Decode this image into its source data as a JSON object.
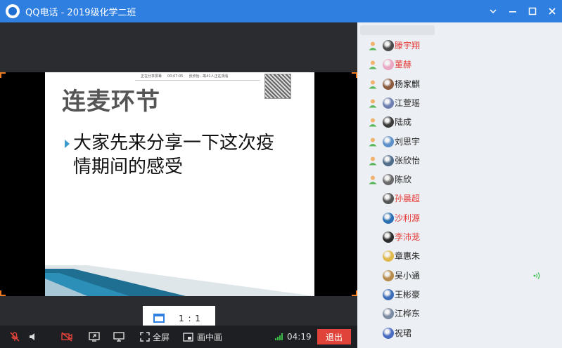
{
  "window": {
    "title": "QQ电话 - 2019级化学二班"
  },
  "slide": {
    "heading": "连麦环节",
    "bullet_line1": "大家先来分享一下这次疫",
    "bullet_line2": "情期间的感受",
    "bar_text_1": "正在分享屏幕",
    "bar_text_2": "00:07:05",
    "bar_text_3": "张欣怡...等41人正在观看"
  },
  "ratio_button": {
    "label": "1 : 1"
  },
  "toolbar": {
    "fullscreen_label": "全屏",
    "pip_label": "画中画",
    "duration": "04:19",
    "exit_label": "退出"
  },
  "members": [
    {
      "name": "滕宇翔",
      "color": "#e53935",
      "speaking": false,
      "avatar_color": "#4a4a4a",
      "indent": false
    },
    {
      "name": "董赫",
      "color": "#e53935",
      "speaking": false,
      "avatar_color": "#e9a7c4",
      "indent": false
    },
    {
      "name": "杨家麒",
      "color": "#222222",
      "speaking": false,
      "avatar_color": "#8a5a3c",
      "indent": false
    },
    {
      "name": "江萱瑶",
      "color": "#222222",
      "speaking": false,
      "avatar_color": "#6d7fb0",
      "indent": false
    },
    {
      "name": "陆成",
      "color": "#222222",
      "speaking": false,
      "avatar_color": "#3b3b3b",
      "indent": false
    },
    {
      "name": "刘思宇",
      "color": "#222222",
      "speaking": false,
      "avatar_color": "#5d8fc9",
      "indent": false
    },
    {
      "name": "张欣怡",
      "color": "#222222",
      "speaking": false,
      "avatar_color": "#4f6b8a",
      "indent": false
    },
    {
      "name": "陈欣",
      "color": "#222222",
      "speaking": false,
      "avatar_color": "#6a6a6a",
      "indent": false
    },
    {
      "name": "孙晨超",
      "color": "#e53935",
      "speaking": false,
      "avatar_color": "#555555",
      "indent": true
    },
    {
      "name": "沙利源",
      "color": "#e53935",
      "speaking": false,
      "avatar_color": "#2a6fb3",
      "indent": true
    },
    {
      "name": "李沛茏",
      "color": "#e53935",
      "speaking": false,
      "avatar_color": "#2c2c2c",
      "indent": true
    },
    {
      "name": "章惠朱",
      "color": "#222222",
      "speaking": false,
      "avatar_color": "#e0b84a",
      "indent": true
    },
    {
      "name": "吴小通",
      "color": "#222222",
      "speaking": true,
      "avatar_color": "#b58a4a",
      "indent": true
    },
    {
      "name": "王彬豪",
      "color": "#222222",
      "speaking": false,
      "avatar_color": "#3f6fb8",
      "indent": true
    },
    {
      "name": "江桦东",
      "color": "#222222",
      "speaking": false,
      "avatar_color": "#7a8aa0",
      "indent": true
    },
    {
      "name": "祝珺",
      "color": "#222222",
      "speaking": false,
      "avatar_color": "#4a6cc0",
      "indent": true
    }
  ]
}
